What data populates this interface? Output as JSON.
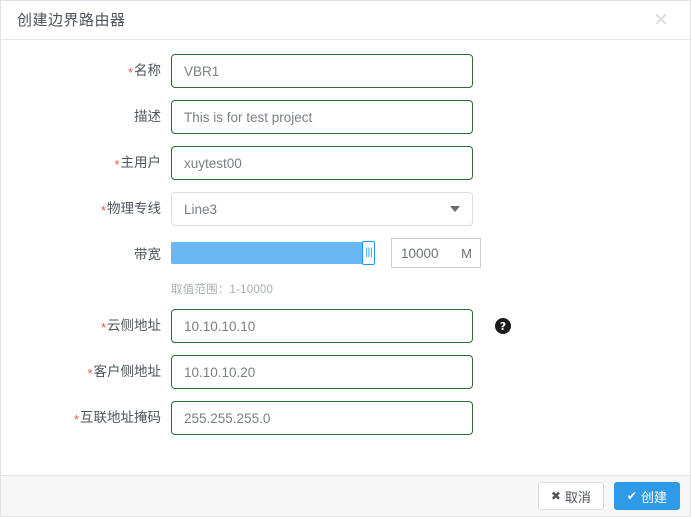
{
  "dialog": {
    "title": "创建边界路由器",
    "close_icon": "close-icon"
  },
  "form": {
    "name": {
      "label": "名称",
      "required": true,
      "value": "VBR1"
    },
    "description": {
      "label": "描述",
      "required": false,
      "value": "This is for test project"
    },
    "main_user": {
      "label": "主用户",
      "required": true,
      "value": "xuytest00"
    },
    "physical_line": {
      "label": "物理专线",
      "required": true,
      "value": "Line3"
    },
    "bandwidth": {
      "label": "带宽",
      "required": false,
      "value": "10000",
      "unit": "M",
      "hint": "取值范围：1-10000",
      "slider_percent": 100,
      "min": 1,
      "max": 10000
    },
    "cloud_address": {
      "label": "云侧地址",
      "required": true,
      "value": "10.10.10.10",
      "help_icon": "help-icon",
      "help_glyph": "?"
    },
    "client_address": {
      "label": "客户侧地址",
      "required": true,
      "value": "10.10.10.20"
    },
    "interconnect_mask": {
      "label": "互联地址掩码",
      "required": true,
      "value": "255.255.255.0"
    }
  },
  "footer": {
    "cancel_label": "取消",
    "cancel_icon": "✖",
    "create_label": "创建",
    "create_icon": "✔"
  },
  "colors": {
    "input_border_valid": "#2e6b32",
    "required_star": "#e8564a",
    "primary_button": "#2f9be8",
    "slider_fill": "#69b7f5",
    "slider_handle_border": "#2196f3",
    "footer_bg": "#f7f7f7"
  }
}
